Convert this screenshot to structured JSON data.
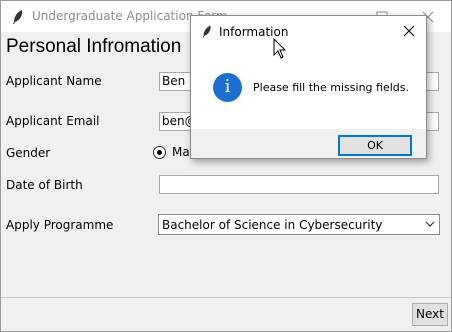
{
  "window": {
    "title": "Undergraduate Application Form"
  },
  "form": {
    "heading": "Personal Infromation",
    "name_label": "Applicant Name",
    "name_value": "Ben",
    "email_label": "Applicant Email",
    "email_value": "ben@",
    "gender_label": "Gender",
    "gender_selected": "Ma",
    "dob_label": "Date of Birth",
    "dob_value": "",
    "programme_label": "Apply Programme",
    "programme_value": "Bachelor of Science in Cybersecurity",
    "next_label": "Next"
  },
  "dialog": {
    "title": "Information",
    "message": "Please fill the missing fields.",
    "ok_label": "OK",
    "icon": "info-icon",
    "icon_color": "#1a6fd1"
  }
}
